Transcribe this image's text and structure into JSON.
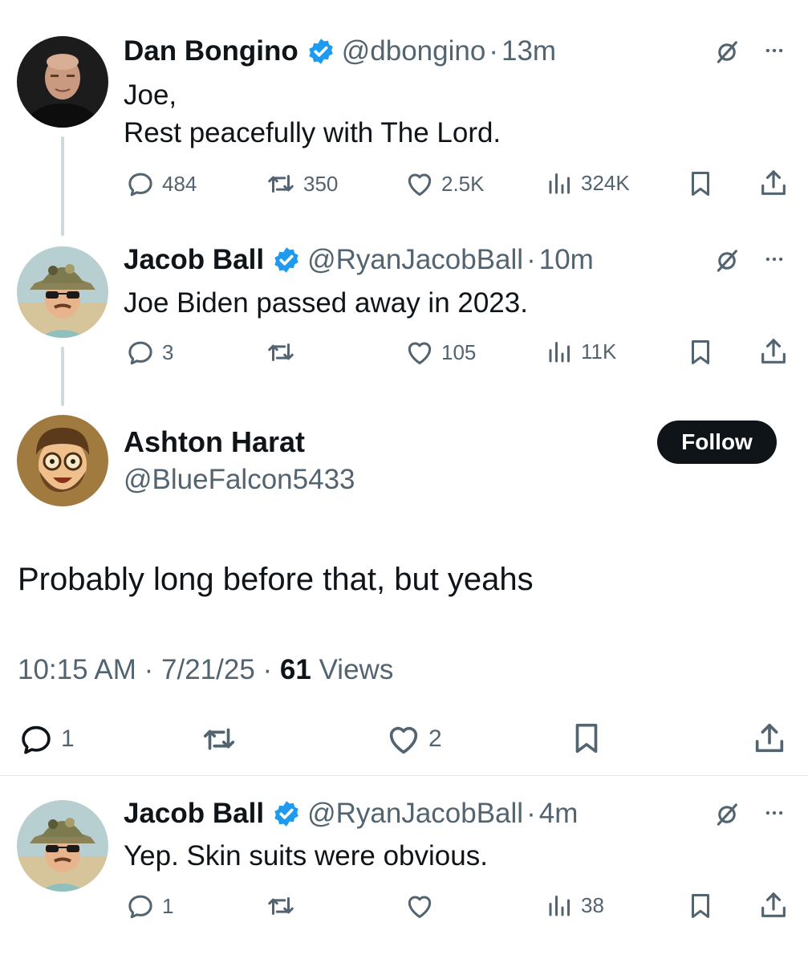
{
  "tweets": [
    {
      "name": "Dan Bongino",
      "handle": "@dbongino",
      "dot": "·",
      "time": "13m",
      "lines": [
        "Joe,",
        "Rest peacefully with The Lord."
      ],
      "replies": "484",
      "reposts": "350",
      "likes": "2.5K",
      "views": "324K"
    },
    {
      "name": "Jacob Ball",
      "handle": "@RyanJacobBall",
      "dot": "·",
      "time": "10m",
      "lines": [
        "Joe Biden passed away in 2023."
      ],
      "replies": "3",
      "reposts": "",
      "likes": "105",
      "views": "11K"
    }
  ],
  "main": {
    "name": "Ashton Harat",
    "handle": "@BlueFalcon5433",
    "follow_label": "Follow",
    "text": "Probably long before that, but yeahs",
    "time": "10:15 AM",
    "date": "7/21/25",
    "views_count": "61",
    "views_label": "Views",
    "sep": "·",
    "replies": "1",
    "likes": "2"
  },
  "reply": {
    "name": "Jacob Ball",
    "handle": "@RyanJacobBall",
    "dot": "·",
    "time": "4m",
    "text": "Yep. Skin suits were obvious.",
    "replies": "1",
    "views": "38"
  },
  "colors": {
    "text": "#0f1419",
    "muted": "#536471",
    "verified": "#1d9bf0",
    "thread_line": "#cfd9de",
    "follow_bg": "#0f1419"
  },
  "icons": [
    "verified-badge-icon",
    "grok-icon",
    "more-icon",
    "reply-icon",
    "repost-icon",
    "like-icon",
    "views-icon",
    "bookmark-icon",
    "share-icon"
  ]
}
